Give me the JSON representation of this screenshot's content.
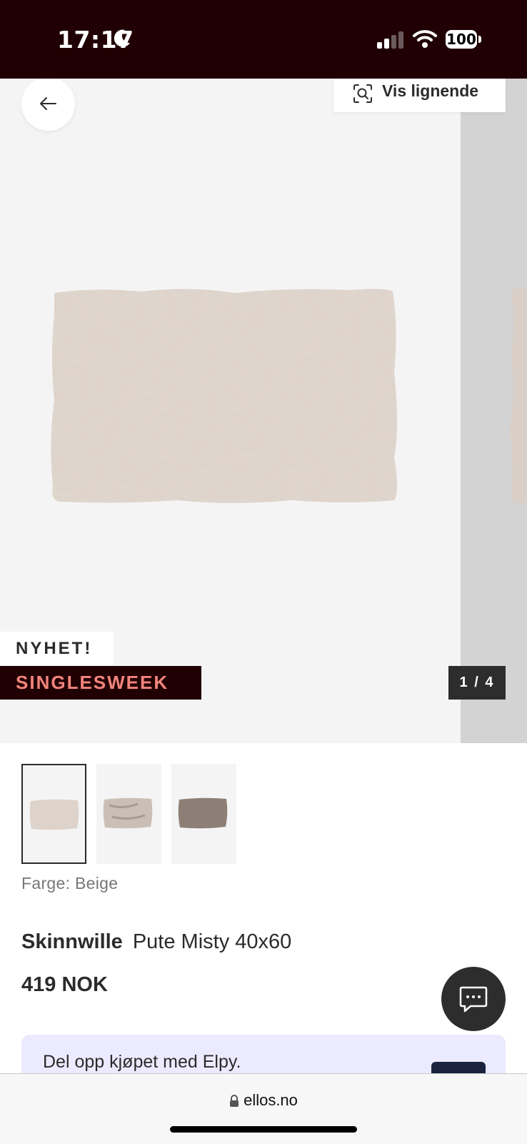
{
  "status_bar": {
    "time": "17:17",
    "battery": "100",
    "icons": [
      "moon-icon",
      "signal-icon",
      "wifi-icon",
      "battery-icon"
    ]
  },
  "gallery": {
    "similar_label": "Vis lignende",
    "badge_new": "NYHET!",
    "badge_sale": "SINGLESWEEK",
    "counter": "1 / 4"
  },
  "thumbnails": [
    {
      "tone": "#ddd3ca",
      "selected": true
    },
    {
      "tone": "#c9bfb5",
      "selected": false
    },
    {
      "tone": "#8d7f76",
      "selected": false
    }
  ],
  "product": {
    "color_label": "Farge: Beige",
    "brand": "Skinnwille",
    "name": "Pute Misty 40x60",
    "price": "419 NOK"
  },
  "banner": {
    "text": "Del opp kjøpet med Elpy."
  },
  "browser": {
    "url": "ellos.no"
  },
  "colors": {
    "header_bg": "#210004",
    "sale_text": "#f2847c",
    "banner_bg": "#eceaff"
  }
}
